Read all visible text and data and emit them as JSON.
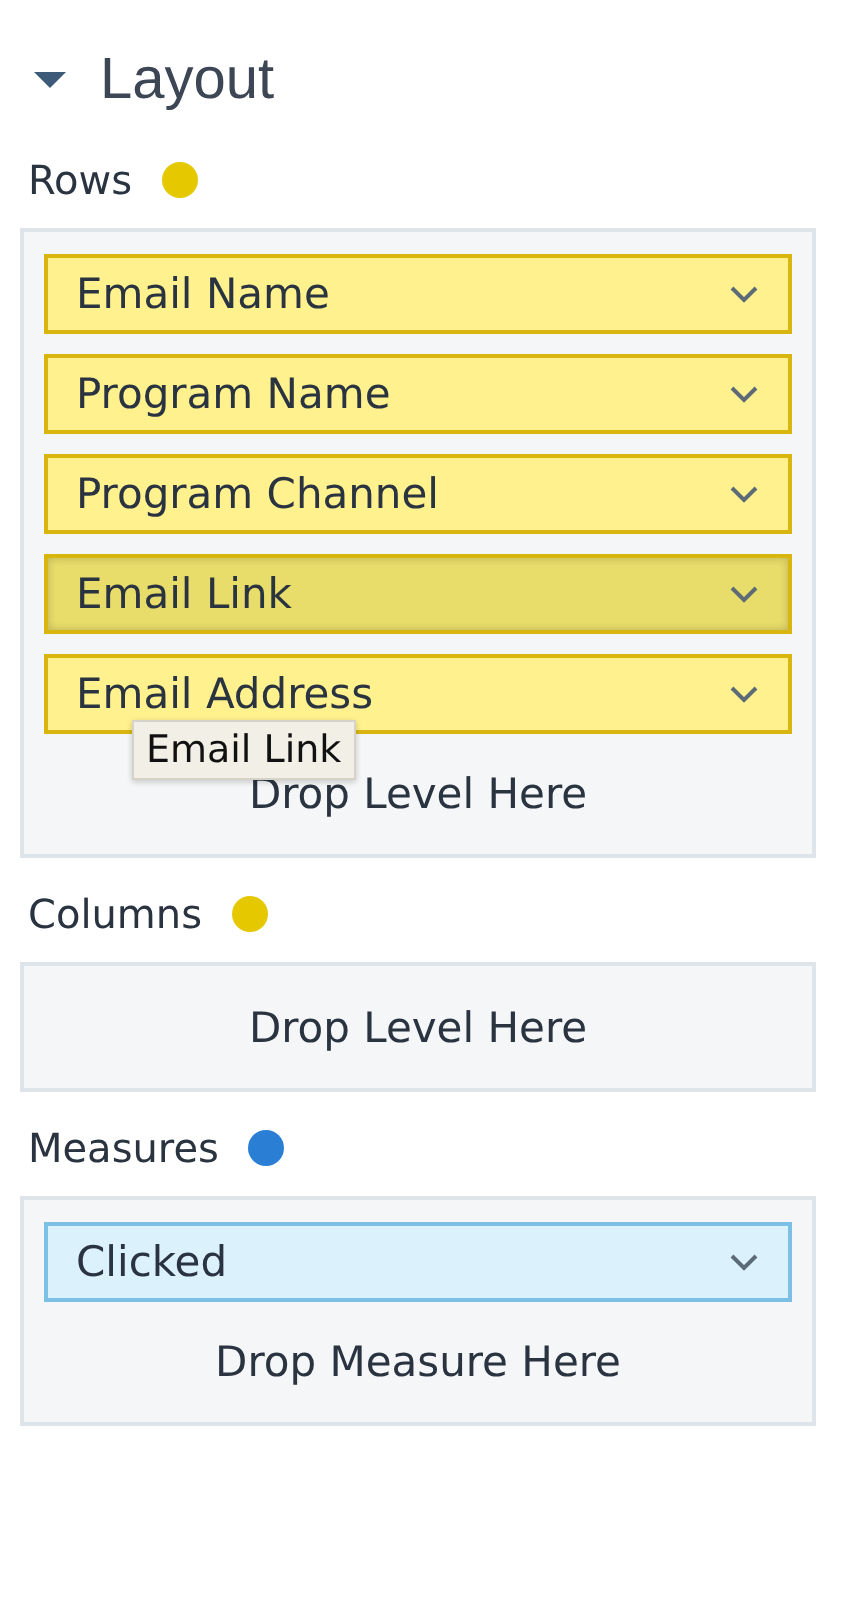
{
  "header": {
    "title": "Layout",
    "expanded": true
  },
  "sections": [
    {
      "label": "Rows",
      "color": "#e6c800",
      "kind": "level",
      "items": [
        {
          "label": "Email Name",
          "highlighted": false
        },
        {
          "label": "Program Name",
          "highlighted": false
        },
        {
          "label": "Program Channel",
          "highlighted": false
        },
        {
          "label": "Email Link",
          "highlighted": true
        },
        {
          "label": "Email Address",
          "highlighted": false
        }
      ],
      "drop_hint": "Drop Level Here",
      "tooltip": "Email Link"
    },
    {
      "label": "Columns",
      "color": "#e6c800",
      "kind": "level",
      "drop_hint": "Drop Level Here"
    },
    {
      "label": "Measures",
      "color": "#2a7fd4",
      "kind": "measure",
      "items": [
        {
          "label": "Clicked",
          "highlighted": false
        }
      ],
      "drop_hint": "Drop Measure Here"
    }
  ]
}
